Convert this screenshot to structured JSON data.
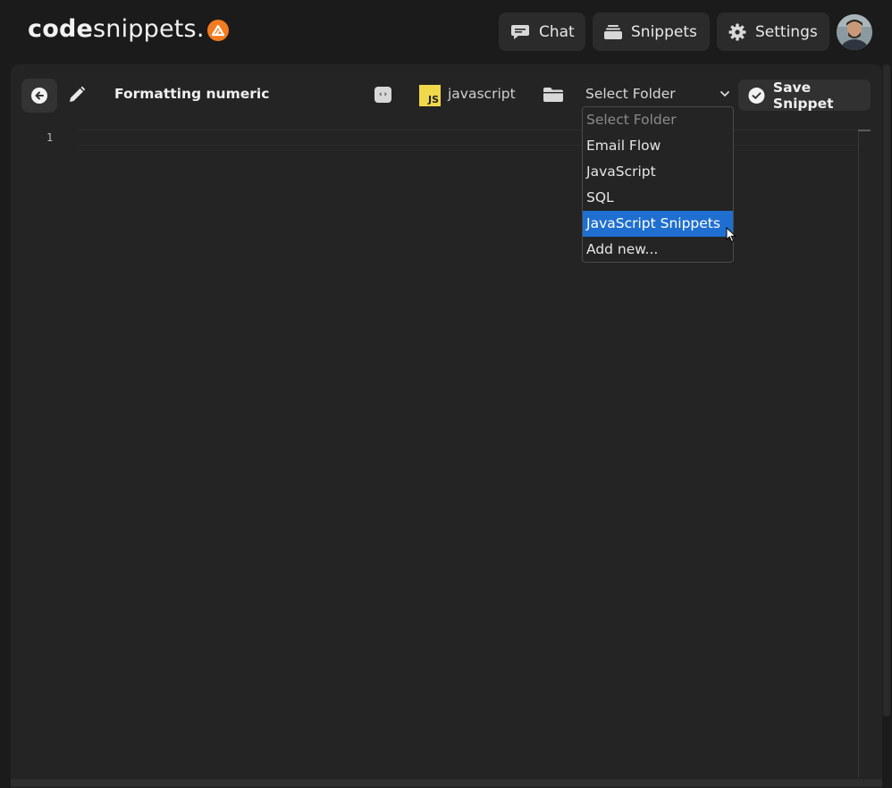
{
  "app": {
    "logo_bold": "code",
    "logo_thin": "snippets.",
    "logo_mark_icon": "triangle-logo-icon",
    "accent_color": "#f47b20"
  },
  "nav": {
    "chat_label": "Chat",
    "snippets_label": "Snippets",
    "settings_label": "Settings"
  },
  "editor": {
    "title": "Formatting numeric valu",
    "language": "javascript",
    "language_badge": "JS",
    "code_icon_glyph": "‹›",
    "save_label": "Save Snippet",
    "line_numbers": [
      "1"
    ]
  },
  "folder_select": {
    "selected": "Select Folder",
    "options": [
      {
        "label": "Select Folder",
        "placeholder": true
      },
      {
        "label": "Email Flow"
      },
      {
        "label": "JavaScript"
      },
      {
        "label": "SQL"
      },
      {
        "label": "JavaScript Snippets",
        "highlighted": true
      },
      {
        "label": "Add new..."
      }
    ],
    "highlight_color": "#1f6fd0"
  }
}
